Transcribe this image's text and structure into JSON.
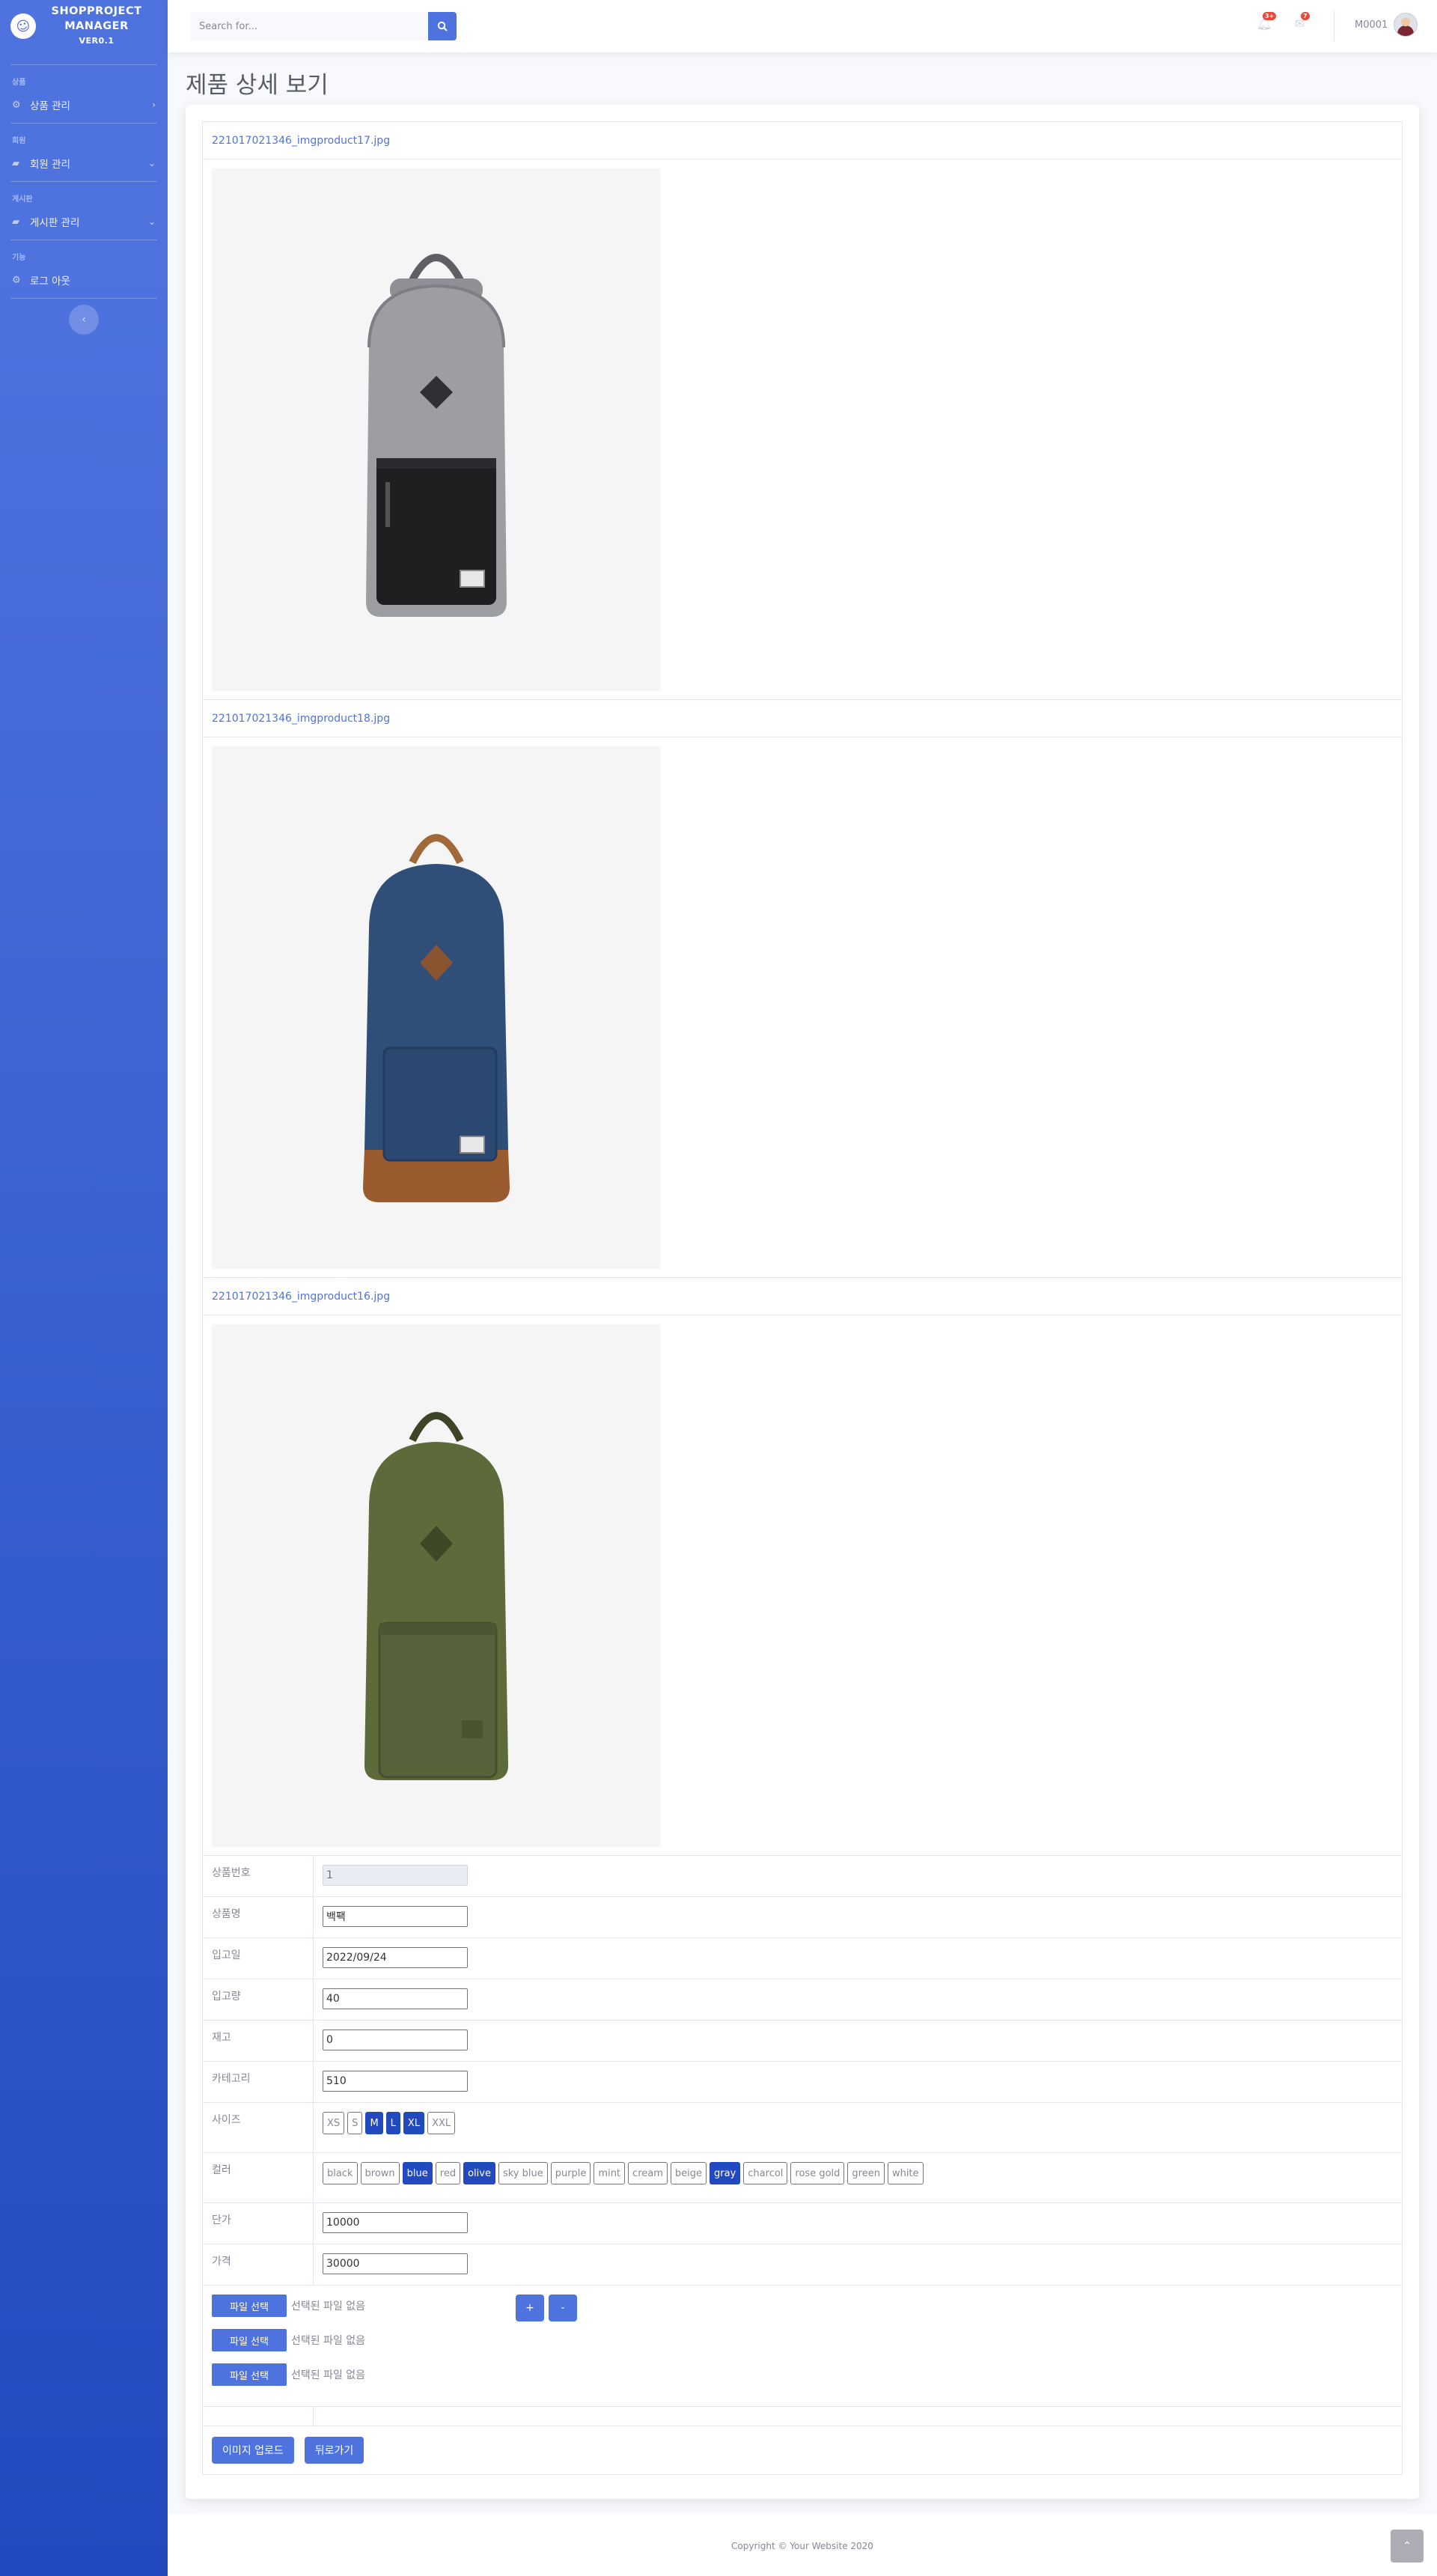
{
  "sidebar": {
    "brand_title": "SHOPPROJECT MANAGER",
    "brand_version": "VER0.1",
    "sections": [
      {
        "heading": "상품",
        "item": "상품 관리"
      },
      {
        "heading": "회원",
        "item": "회원 관리"
      },
      {
        "heading": "게시판",
        "item": "게시판 관리"
      },
      {
        "heading": "기능",
        "item": "로그 아웃"
      }
    ]
  },
  "topbar": {
    "search_placeholder": "Search for...",
    "alerts_badge": "3+",
    "messages_badge": "7",
    "user_name": "M0001"
  },
  "page": {
    "title": "제품 상세 보기",
    "images": [
      {
        "filename": "221017021346_imgproduct17.jpg",
        "color": "gray"
      },
      {
        "filename": "221017021346_imgproduct18.jpg",
        "color": "navy"
      },
      {
        "filename": "221017021346_imgproduct16.jpg",
        "color": "olive"
      }
    ],
    "fields": {
      "product_no": {
        "label": "상품번호",
        "value": "1"
      },
      "product_name": {
        "label": "상품명",
        "value": "백팩"
      },
      "stock_date": {
        "label": "입고일",
        "value": "2022/09/24"
      },
      "stock_qty": {
        "label": "입고량",
        "value": "40"
      },
      "inventory": {
        "label": "재고",
        "value": "0"
      },
      "category": {
        "label": "카테고리",
        "value": "510"
      },
      "unit_cost": {
        "label": "단가",
        "value": "10000"
      },
      "price": {
        "label": "가격",
        "value": "30000"
      }
    },
    "size_label": "사이즈",
    "sizes": [
      {
        "name": "XS",
        "selected": false
      },
      {
        "name": "S",
        "selected": false
      },
      {
        "name": "M",
        "selected": true
      },
      {
        "name": "L",
        "selected": true
      },
      {
        "name": "XL",
        "selected": true
      },
      {
        "name": "XXL",
        "selected": false
      }
    ],
    "color_label": "컬러",
    "colors": [
      {
        "name": "black",
        "selected": false
      },
      {
        "name": "brown",
        "selected": false
      },
      {
        "name": "blue",
        "selected": true
      },
      {
        "name": "red",
        "selected": false
      },
      {
        "name": "olive",
        "selected": true
      },
      {
        "name": "sky blue",
        "selected": false
      },
      {
        "name": "purple",
        "selected": false
      },
      {
        "name": "mint",
        "selected": false
      },
      {
        "name": "cream",
        "selected": false
      },
      {
        "name": "beige",
        "selected": false
      },
      {
        "name": "gray",
        "selected": true
      },
      {
        "name": "charcol",
        "selected": false
      },
      {
        "name": "rose gold",
        "selected": false
      },
      {
        "name": "green",
        "selected": false
      },
      {
        "name": "white",
        "selected": false
      }
    ],
    "file_button": "파일 선택",
    "file_none": "선택된 파일 없음",
    "plus": "+",
    "minus": "-",
    "upload_button": "이미지 업로드",
    "back_button": "뒤로가기"
  },
  "footer": {
    "copyright": "Copyright © Your Website 2020"
  },
  "colors": {
    "primary": "#4e73df",
    "primary_dark": "#224abe",
    "danger": "#e74a3b"
  }
}
